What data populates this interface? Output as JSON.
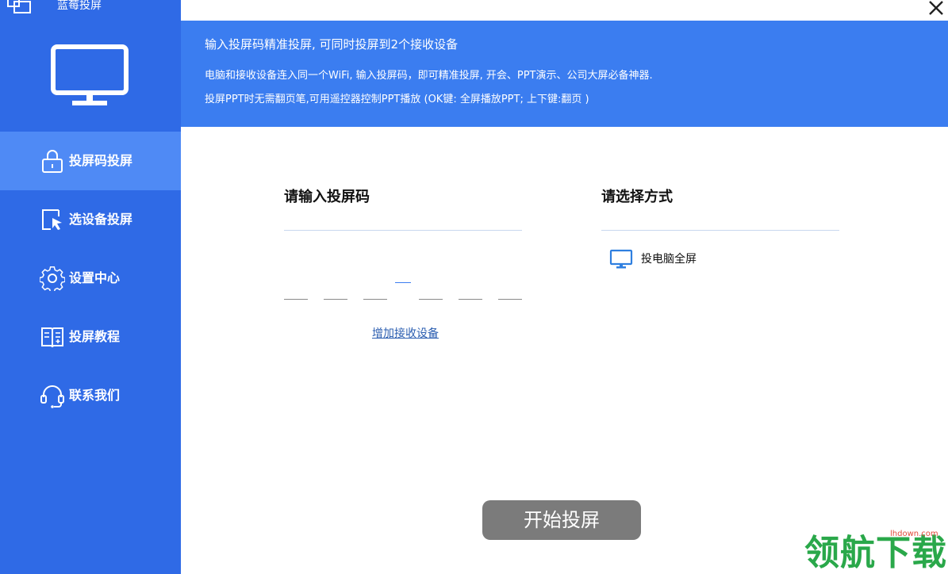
{
  "app": {
    "title": "蓝莓投屏"
  },
  "sidebar": {
    "items": [
      {
        "label": "投屏码投屏",
        "icon": "lock-icon",
        "active": true
      },
      {
        "label": "选设备投屏",
        "icon": "cursor-select-icon",
        "active": false
      },
      {
        "label": "设置中心",
        "icon": "gear-icon",
        "active": false
      },
      {
        "label": "投屏教程",
        "icon": "book-icon",
        "active": false
      },
      {
        "label": "联系我们",
        "icon": "headset-icon",
        "active": false
      }
    ]
  },
  "banner": {
    "line1": "输入投屏码精准投屏, 可同时投屏到2个接收设备",
    "line2": "电脑和接收设备连入同一个WiFi, 输入投屏码，即可精准投屏, 开会、PPT演示、公司大屏必备神器.",
    "line3": "投屏PPT时无需翻页笔,可用遥控器控制PPT播放 (OK键: 全屏播放PPT; 上下键:翻页 )"
  },
  "code_section": {
    "title": "请输入投屏码",
    "add_device_label": "增加接收设备"
  },
  "mode_section": {
    "title": "请选择方式",
    "option_label": "投电脑全屏",
    "option_icon": "monitor-icon"
  },
  "start_button": {
    "label": "开始投屏"
  },
  "watermark": {
    "text": "领航下载",
    "url": "lhdown.com"
  },
  "colors": {
    "sidebar": "#2f6ae6",
    "sidebar_active": "#4f8af5",
    "banner": "#3b7df0",
    "button": "#7b7b7b",
    "link": "#2a5db0"
  }
}
